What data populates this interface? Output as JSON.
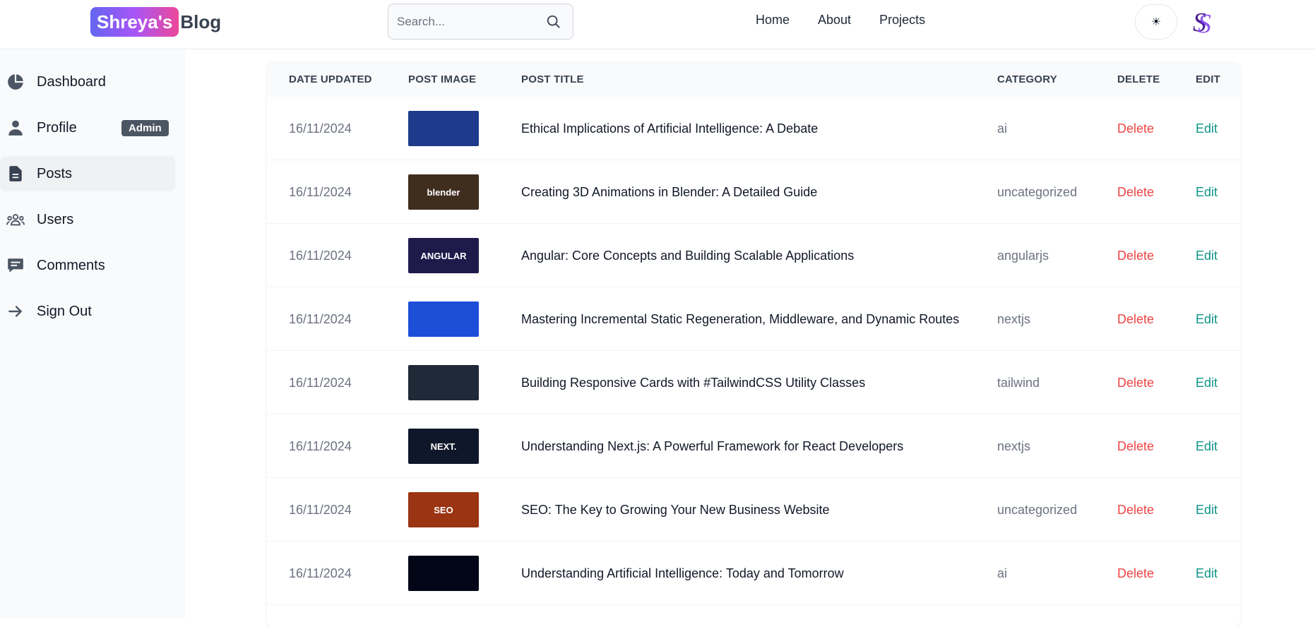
{
  "header": {
    "logo_badge": "Shreya's",
    "logo_rest": "Blog",
    "search_placeholder": "Search...",
    "nav": [
      "Home",
      "About",
      "Projects"
    ],
    "theme_toggle_glyph": "☀"
  },
  "sidebar": {
    "items": [
      {
        "label": "Dashboard",
        "icon": "pie-chart-icon"
      },
      {
        "label": "Profile",
        "icon": "user-icon",
        "badge": "Admin"
      },
      {
        "label": "Posts",
        "icon": "document-icon",
        "active": true
      },
      {
        "label": "Users",
        "icon": "users-group-icon"
      },
      {
        "label": "Comments",
        "icon": "comment-icon"
      },
      {
        "label": "Sign Out",
        "icon": "arrow-right-icon"
      }
    ]
  },
  "table": {
    "headers": [
      "Date updated",
      "Post image",
      "Post title",
      "Category",
      "Delete",
      "Edit"
    ],
    "rows": [
      {
        "date": "16/11/2024",
        "title": "Ethical Implications of Artificial Intelligence: A Debate",
        "category": "ai",
        "delete": "Delete",
        "edit": "Edit",
        "thumb_label": "",
        "thumb_color": "#1e3a8a"
      },
      {
        "date": "16/11/2024",
        "title": "Creating 3D Animations in Blender: A Detailed Guide",
        "category": "uncategorized",
        "delete": "Delete",
        "edit": "Edit",
        "thumb_label": "blender",
        "thumb_color": "#3f2d1e"
      },
      {
        "date": "16/11/2024",
        "title": "Angular: Core Concepts and Building Scalable Applications",
        "category": "angularjs",
        "delete": "Delete",
        "edit": "Edit",
        "thumb_label": "ANGULAR",
        "thumb_color": "#1e1b4b"
      },
      {
        "date": "16/11/2024",
        "title": "Mastering Incremental Static Regeneration, Middleware, and Dynamic Routes",
        "category": "nextjs",
        "delete": "Delete",
        "edit": "Edit",
        "thumb_label": "",
        "thumb_color": "#1d4ed8"
      },
      {
        "date": "16/11/2024",
        "title": "Building Responsive Cards with #TailwindCSS Utility Classes",
        "category": "tailwind",
        "delete": "Delete",
        "edit": "Edit",
        "thumb_label": "",
        "thumb_color": "#1f2937"
      },
      {
        "date": "16/11/2024",
        "title": "Understanding Next.js: A Powerful Framework for React Developers",
        "category": "nextjs",
        "delete": "Delete",
        "edit": "Edit",
        "thumb_label": "NEXT.",
        "thumb_color": "#0f172a"
      },
      {
        "date": "16/11/2024",
        "title": "SEO: The Key to Growing Your New Business Website",
        "category": "uncategorized",
        "delete": "Delete",
        "edit": "Edit",
        "thumb_label": "SEO",
        "thumb_color": "#9a3412"
      },
      {
        "date": "16/11/2024",
        "title": "Understanding Artificial Intelligence: Today and Tomorrow",
        "category": "ai",
        "delete": "Delete",
        "edit": "Edit",
        "thumb_label": "",
        "thumb_color": "#020617"
      }
    ]
  },
  "colors": {
    "delete": "#ef4444",
    "edit": "#0d9488",
    "logo_gradient": [
      "#6366f1",
      "#a855f7",
      "#ec4899"
    ]
  }
}
